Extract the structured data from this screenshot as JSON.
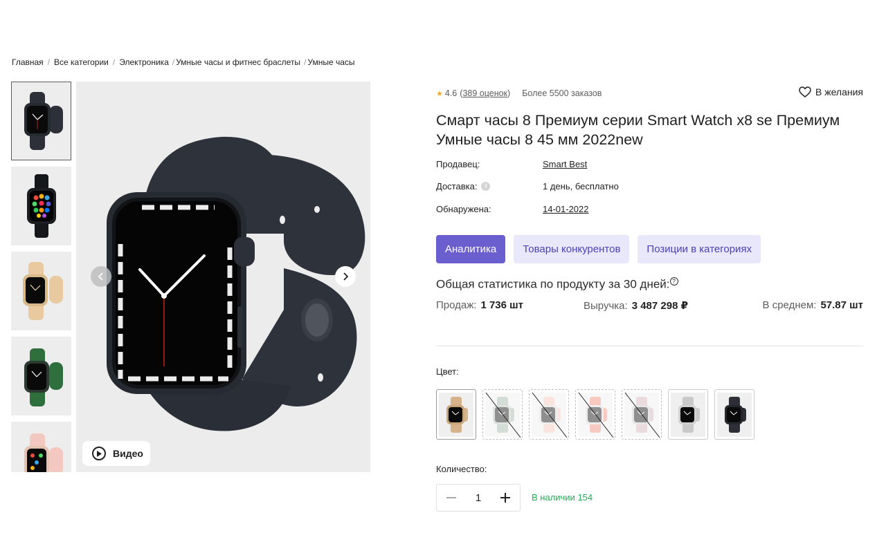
{
  "breadcrumb": {
    "items": [
      "Главная",
      "Все категории",
      "Электроника",
      "Умные часы и фитнес браслеты",
      "Умные часы"
    ]
  },
  "gallery": {
    "thumbnails": [
      {
        "name": "black-watch",
        "strap": "#2d3038",
        "case": "#262a31"
      },
      {
        "name": "black-watch-apps",
        "strap": "#15171a",
        "case": "#1b1d20"
      },
      {
        "name": "beige-watch",
        "strap": "#e8c9a0",
        "case": "#d9b98a"
      },
      {
        "name": "green-watch",
        "strap": "#2f6f3e",
        "case": "#2c3a31"
      },
      {
        "name": "pink-watch",
        "strap": "#f2c8c0",
        "case": "#e4c3b0"
      }
    ],
    "video_label": "Видео",
    "main_strap_color": "#2e323b",
    "main_case_color": "#262a31"
  },
  "product": {
    "rating": "4.6",
    "reviews": "389 оценок",
    "orders": "Более 5500 заказов",
    "wishlist_label": "В желания",
    "title": "Смарт часы 8 Премиум серии Smart Watch x8 se Премиум Умные часы 8 45 мм 2022new",
    "seller_label": "Продавец:",
    "seller_value": "Smart Best",
    "delivery_label": "Доставка:",
    "delivery_value": "1 день, бесплатно",
    "found_label": "Обнаружена:",
    "found_value": "14-01-2022"
  },
  "tabs": [
    {
      "label": "Аналитика",
      "active": true
    },
    {
      "label": "Товары конкурентов",
      "active": false
    },
    {
      "label": "Позиции в категориях",
      "active": false
    }
  ],
  "stats": {
    "title": "Общая статистика по продукту за 30 дней:",
    "help_icon": "?",
    "sales_label": "Продаж:",
    "sales_value": "1 736 шт",
    "revenue_label": "Выручка:",
    "revenue_value": "3 487 298 ₽",
    "avg_label": "В среднем:",
    "avg_value": "57.87 шт"
  },
  "color": {
    "label": "Цвет:",
    "swatches": [
      {
        "name": "beige",
        "strap": "#d7b38b",
        "case": "#c9a57a",
        "available": true
      },
      {
        "name": "sage",
        "strap": "#9fb3a4",
        "case": "#b8c2b9",
        "available": false
      },
      {
        "name": "peach",
        "strap": "#f3c7b5",
        "case": "#d8d8d8",
        "available": false
      },
      {
        "name": "coral",
        "strap": "#f08878",
        "case": "#d9d9d9",
        "available": false
      },
      {
        "name": "rose",
        "strap": "#d7b0b8",
        "case": "#c8c8d0",
        "available": false
      },
      {
        "name": "silver",
        "strap": "#c9c9c9",
        "case": "#d0d0d0",
        "available": true
      },
      {
        "name": "black",
        "strap": "#2c2f35",
        "case": "#24272c",
        "available": true
      }
    ]
  },
  "quantity": {
    "label": "Количество:",
    "value": "1",
    "stock": "В наличии 154"
  },
  "colors": {
    "accent": "#6b5fd0",
    "accent_soft": "#e9e8fb",
    "stock_green": "#1fae52",
    "star": "#f5a623"
  }
}
